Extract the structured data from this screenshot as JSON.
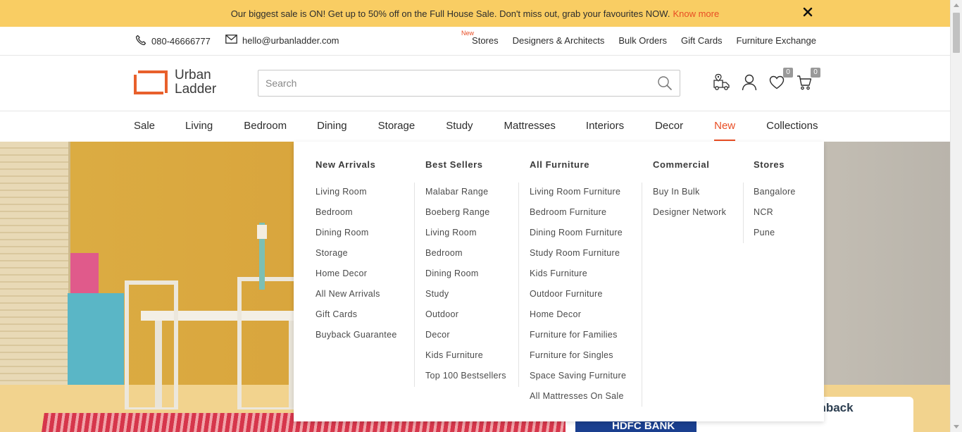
{
  "promo": {
    "message": "Our biggest sale is ON! Get up to 50% off on the Full House Sale. Don't miss out, grab your favourites NOW.",
    "link": "Know more",
    "link_color": "#e84d24",
    "background": "#f9cd63",
    "close_icon": "close-icon"
  },
  "contact": {
    "phone": "080-46666777",
    "email": "hello@urbanladder.com"
  },
  "toplinks": {
    "new_badge": "New",
    "items": [
      "Stores",
      "Designers & Architects",
      "Bulk Orders",
      "Gift Cards",
      "Furniture Exchange"
    ]
  },
  "header": {
    "logo_line1": "Urban",
    "logo_line2": "Ladder",
    "search_placeholder": "Search",
    "wishlist_count": "0",
    "cart_count": "0"
  },
  "nav": {
    "items": [
      "Sale",
      "Living",
      "Bedroom",
      "Dining",
      "Storage",
      "Study",
      "Mattresses",
      "Interiors",
      "Decor",
      "New",
      "Collections"
    ],
    "active": "New"
  },
  "mega": {
    "columns": [
      {
        "title": "New Arrivals",
        "items": [
          "Living Room",
          "Bedroom",
          "Dining Room",
          "Storage",
          "Home Decor",
          "All New Arrivals",
          "Gift Cards",
          "Buyback Guarantee"
        ]
      },
      {
        "title": "Best Sellers",
        "items": [
          "Malabar Range",
          "Boeberg Range",
          "Living Room",
          "Bedroom",
          "Dining Room",
          "Study",
          "Outdoor",
          "Decor",
          "Kids Furniture",
          "Top 100 Bestsellers"
        ]
      },
      {
        "title": "All Furniture",
        "items": [
          "Living Room Furniture",
          "Bedroom Furniture",
          "Dining Room Furniture",
          "Study Room Furniture",
          "Kids Furniture",
          "Outdoor Furniture",
          "Home Decor",
          "Furniture for Families",
          "Furniture for Singles",
          "Space Saving Furniture",
          "All Mattresses On Sale"
        ]
      },
      {
        "title": "Commercial",
        "items": [
          "Buy In Bulk",
          "Designer Network"
        ]
      },
      {
        "title": "Stores",
        "items": [
          "Bangalore",
          "NCR",
          "Pune"
        ]
      }
    ]
  },
  "hero": {
    "cashback_text": "shback",
    "bank": "HDFC BANK"
  }
}
